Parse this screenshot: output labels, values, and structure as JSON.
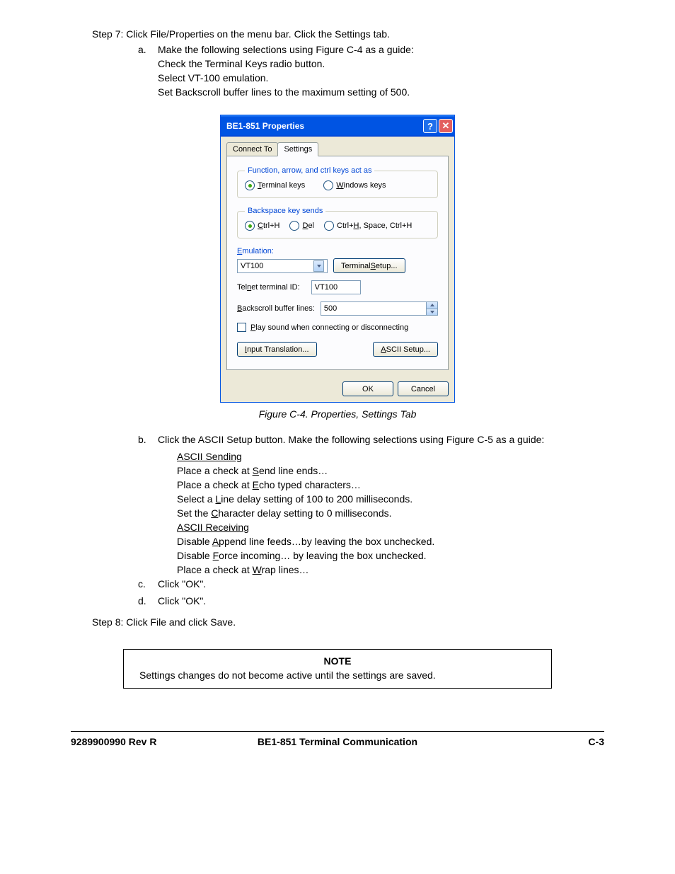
{
  "step7": {
    "text": "Step 7:  Click File/Properties on the menu bar. Click the Settings tab.",
    "a": {
      "letter": "a.",
      "lines": [
        "Make the following selections using Figure C-4 as a guide:",
        "Check the Terminal Keys radio button.",
        "Select VT-100 emulation.",
        "Set Backscroll buffer lines to the maximum setting of 500."
      ]
    }
  },
  "dialog": {
    "title": "BE1-851 Properties",
    "tabs": {
      "connect_to": "Connect To",
      "settings": "Settings"
    },
    "group1": {
      "legend": "Function, arrow, and ctrl keys act as",
      "terminal": "Terminal keys",
      "windows": "Windows keys"
    },
    "group2": {
      "legend": "Backspace key sends",
      "opt1": "Ctrl+H",
      "opt2": "Del",
      "opt3": "Ctrl+H, Space, Ctrl+H"
    },
    "emulation_label": "Emulation:",
    "emulation_value": "VT100",
    "terminal_setup": "Terminal Setup...",
    "telnet_label": "Telnet terminal ID:",
    "telnet_value": "VT100",
    "backscroll_label": "Backscroll buffer lines:",
    "backscroll_value": "500",
    "play_sound": "Play sound when connecting or disconnecting",
    "input_translation": "Input Translation...",
    "ascii_setup": "ASCII Setup...",
    "ok": "OK",
    "cancel": "Cancel"
  },
  "figure_caption": "Figure C-4. Properties, Settings Tab",
  "item_b": {
    "letter": "b.",
    "intro": "Click the ASCII Setup button. Make the following selections using Figure C-5 as a guide:",
    "sending_hdr": "ASCII Sending",
    "sending": [
      "Place a check at Send line ends…",
      "Place a check at Echo typed characters…",
      "Select a Line delay setting of 100 to 200 milliseconds.",
      "Set the Character delay setting to 0 milliseconds."
    ],
    "receiving_hdr": "ASCII Receiving",
    "receiving": [
      "Disable Append line feeds…by leaving the box unchecked.",
      "Disable Force incoming… by leaving the box unchecked.",
      "Place a check at Wrap lines…"
    ]
  },
  "item_c": {
    "letter": "c.",
    "text": "Click \"OK\"."
  },
  "item_d": {
    "letter": "d.",
    "text": "Click \"OK\"."
  },
  "step8": "Step 8: Click File and click Save.",
  "note": {
    "title": "NOTE",
    "text": "Settings changes do not become active until the settings are saved."
  },
  "footer": {
    "left": "9289900990 Rev R",
    "center": "BE1-851 Terminal Communication",
    "right": "C-3"
  }
}
